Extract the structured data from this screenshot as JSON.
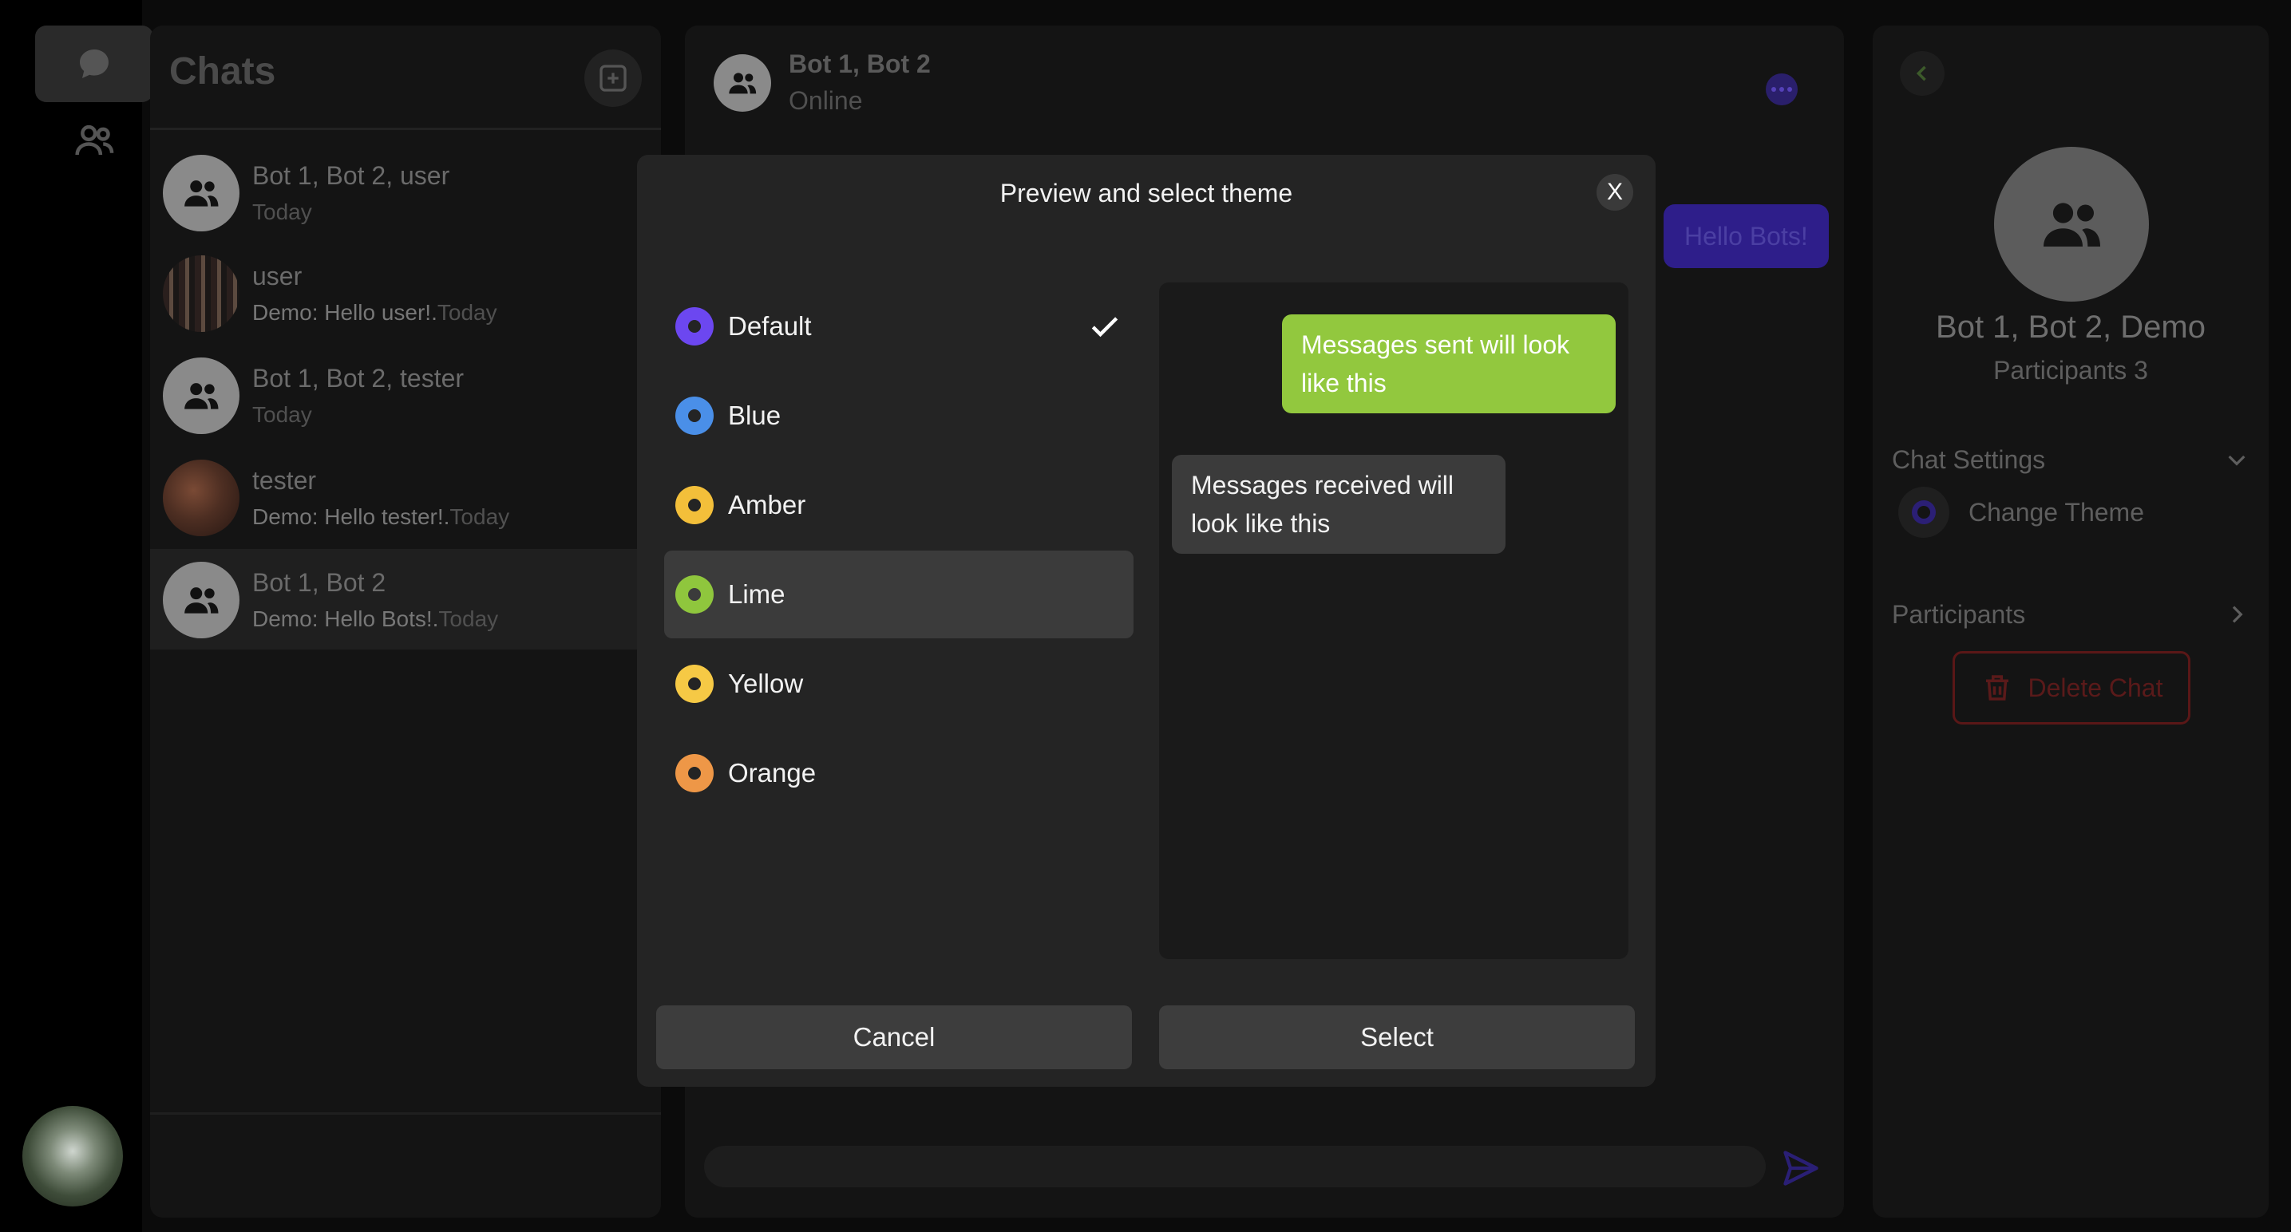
{
  "nav": {
    "items": [
      {
        "name": "chats",
        "icon": "chat-bubble-icon"
      },
      {
        "name": "contacts",
        "icon": "people-icon"
      }
    ],
    "user_avatar_icon": "user-photo"
  },
  "chats_panel": {
    "title": "Chats",
    "new_chat_icon": "plus-square-icon",
    "items": [
      {
        "name": "Bot 1, Bot 2, user",
        "preview": "",
        "time": "Today",
        "avatar": "group-icon"
      },
      {
        "name": "user",
        "preview": "Demo: Hello user!.",
        "time": "Today",
        "avatar": "photo"
      },
      {
        "name": "Bot 1, Bot 2, tester",
        "preview": "",
        "time": "Today",
        "avatar": "group-icon"
      },
      {
        "name": "tester",
        "preview": "Demo: Hello tester!.",
        "time": "Today",
        "avatar": "photo"
      },
      {
        "name": "Bot 1, Bot 2",
        "preview": "Demo: Hello Bots!.",
        "time": "Today",
        "avatar": "group-icon"
      }
    ]
  },
  "conversation": {
    "title": "Bot 1, Bot 2",
    "status": "Online",
    "messages": [
      {
        "text": "Hello Bots!",
        "direction": "sent"
      }
    ],
    "send_icon": "send-icon"
  },
  "info_panel": {
    "name": "Bot 1, Bot 2, Demo",
    "participants_count": "Participants 3",
    "chat_settings_label": "Chat Settings",
    "change_theme_label": "Change Theme",
    "participants_label": "Participants",
    "delete_label": "Delete Chat"
  },
  "modal": {
    "title": "Preview and select theme",
    "close_label": "X",
    "themes": [
      {
        "label": "Default",
        "color": "#6c47f0",
        "selected": true
      },
      {
        "label": "Blue",
        "color": "#4a8fe8",
        "selected": false
      },
      {
        "label": "Amber",
        "color": "#f3bf3a",
        "selected": false
      },
      {
        "label": "Lime",
        "color": "#8fc63d",
        "selected": false
      },
      {
        "label": "Yellow",
        "color": "#f6c945",
        "selected": false
      },
      {
        "label": "Orange",
        "color": "#ee9747",
        "selected": false
      }
    ],
    "preview": {
      "sent_text": "Messages sent will look like this",
      "received_text": "Messages received will look like this",
      "sent_color": "#92c83e"
    },
    "cancel_label": "Cancel",
    "select_label": "Select"
  }
}
